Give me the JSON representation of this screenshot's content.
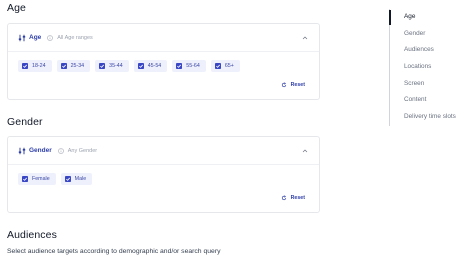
{
  "sections": {
    "age": {
      "title": "Age",
      "card_title": "Age",
      "hint": "All Age ranges",
      "options": [
        "18-24",
        "25-34",
        "35-44",
        "45-54",
        "55-64",
        "65+"
      ],
      "reset_label": "Reset"
    },
    "gender": {
      "title": "Gender",
      "card_title": "Gender",
      "hint": "Any Gender",
      "options": [
        "Female",
        "Male"
      ],
      "reset_label": "Reset"
    },
    "audiences": {
      "title": "Audiences",
      "description": "Select audience targets according to demographic and/or search query"
    }
  },
  "toc": {
    "items": [
      "Age",
      "Gender",
      "Audiences",
      "Locations",
      "Screen",
      "Content",
      "Delivery time slots"
    ],
    "active": "Age"
  },
  "colors": {
    "accent": "#2d3ea8",
    "chip_bg": "#eef0fb",
    "checkbox": "#3947c4"
  },
  "icons": {
    "filter": "sliders-icon",
    "info": "info-icon",
    "collapse": "chevron-up-icon",
    "reset": "refresh-icon",
    "checked": "checkbox-checked-icon"
  }
}
